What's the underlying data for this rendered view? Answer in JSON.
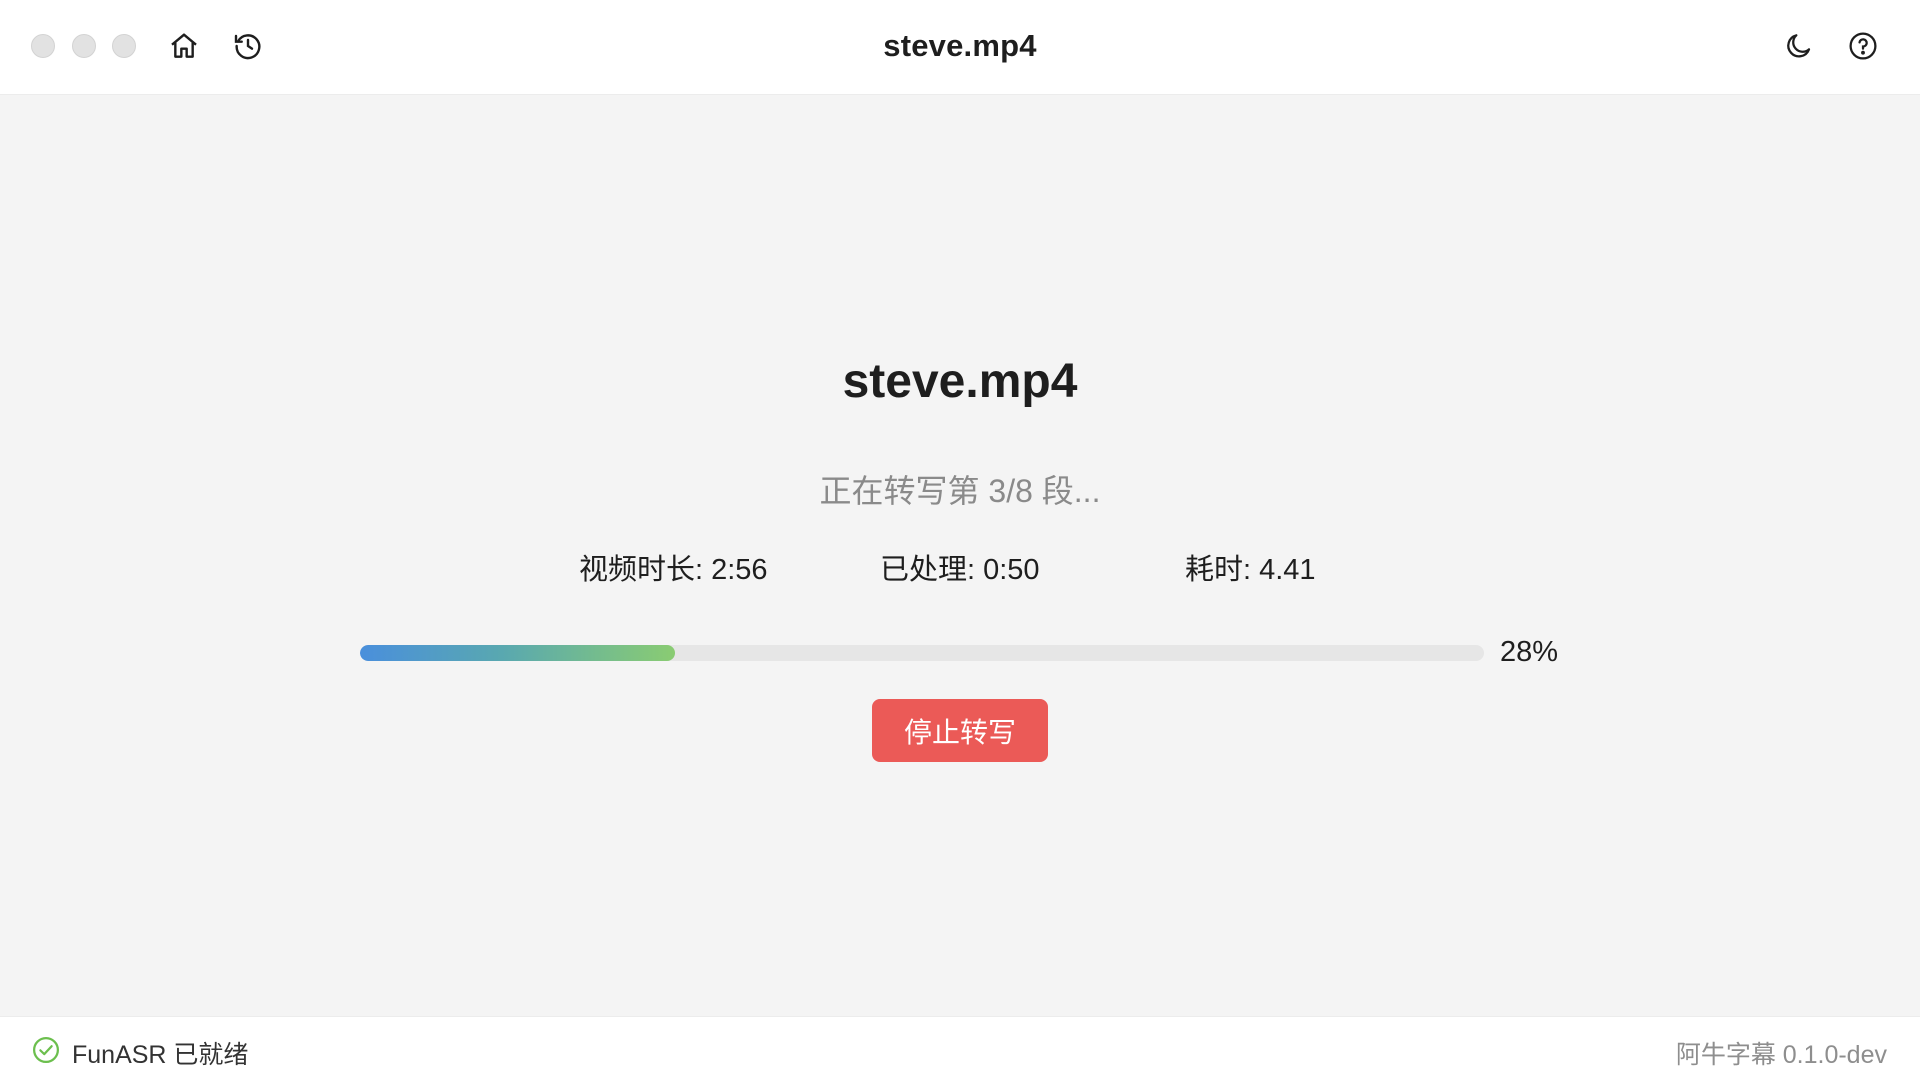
{
  "window": {
    "title": "steve.mp4",
    "icons": [
      "home-icon",
      "history-icon",
      "moon-icon",
      "help-icon"
    ]
  },
  "transcription": {
    "file_title": "steve.mp4",
    "status": "正在转写第 3/8 段...",
    "stats": {
      "duration": "视频时长: 2:56",
      "processed": "已处理: 0:50",
      "elapsed": "耗时: 4.41"
    },
    "progress": {
      "value": 0.28,
      "label": "28%"
    },
    "stop_button": "停止转写"
  },
  "footer": {
    "engine_status": "FunASR 已就绪",
    "app_version": "阿牛字幕 0.1.0-dev"
  },
  "colors": {
    "stop_button": "#eb5a57",
    "progress_start": "#4a8fdc",
    "progress_end": "#8acc72",
    "ready_icon": "#6cbf4e"
  }
}
